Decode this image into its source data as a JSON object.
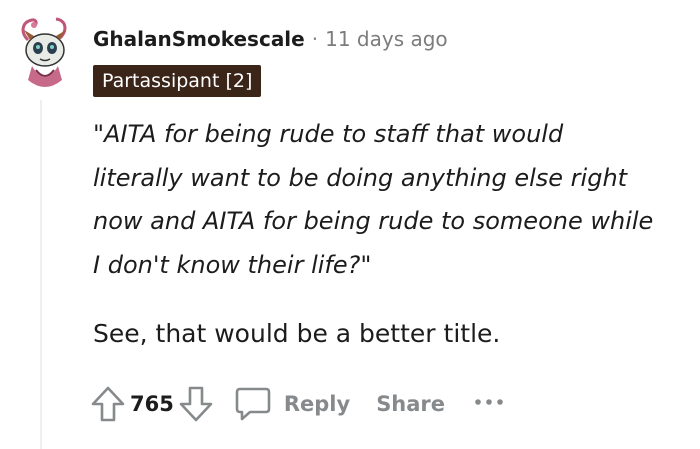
{
  "comment": {
    "username": "GhalanSmokescale",
    "separator": "·",
    "timestamp": "11 days ago",
    "flair": "Partassipant [2]",
    "quote_lines": [
      "\"AITA for being rude to staff that would",
      "literally want to be doing anything else right",
      "now and AITA for being rude to someone while",
      "I don't know their life?\""
    ],
    "text": "See, that would be a better title."
  },
  "actions": {
    "score": "765",
    "reply_label": "Reply",
    "share_label": "Share"
  },
  "icons": {
    "avatar": "avatar",
    "upvote": "upvote-arrow-icon",
    "downvote": "downvote-arrow-icon",
    "reply": "speech-bubble-icon",
    "more": "more-dots-icon"
  },
  "colors": {
    "flair_bg": "#3b2418",
    "muted": "#878a8c"
  }
}
